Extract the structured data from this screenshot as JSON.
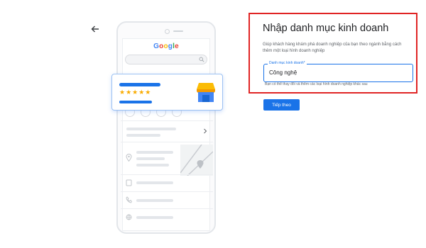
{
  "illustration": {
    "logo_text": "Google",
    "logo_colors": [
      "#4285F4",
      "#EA4335",
      "#FBBC05",
      "#4285F4",
      "#34A853",
      "#EA4335"
    ],
    "rating_stars": "★★★★★",
    "rating_value": 5
  },
  "form": {
    "title": "Nhập danh mục kinh doanh",
    "description": "Giúp khách hàng khám phá doanh nghiệp của bạn theo ngành bằng cách thêm một loại hình doanh nghiệp",
    "field_label": "Danh mục kinh doanh*",
    "field_value": "Công nghệ",
    "hint": "Bạn có thể thay đổi và thêm các loại hình doanh nghiệp khác sau",
    "next_label": "Tiếp theo"
  },
  "colors": {
    "accent": "#1a73e8",
    "highlight_border": "#e02424",
    "star": "#f9ab00"
  },
  "icons": [
    "back-arrow-icon",
    "search-icon",
    "store-icon",
    "map-pin-icon",
    "phone-icon",
    "globe-icon",
    "chevron-right-icon"
  ]
}
